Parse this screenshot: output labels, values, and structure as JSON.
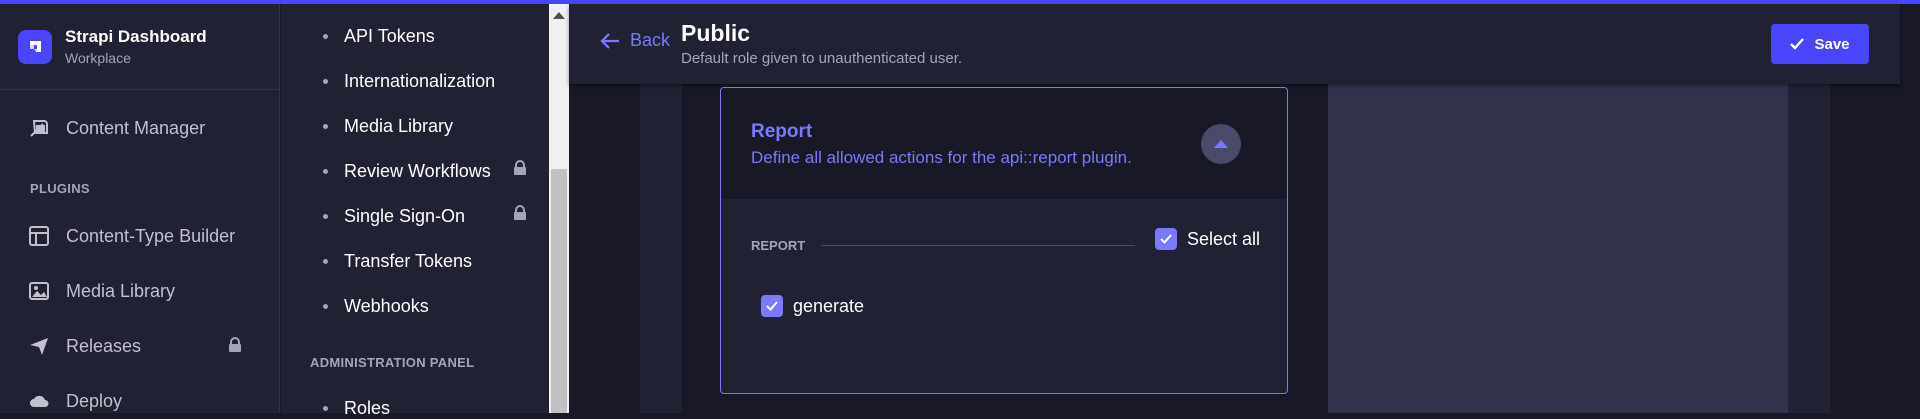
{
  "brand": {
    "title": "Strapi Dashboard",
    "subtitle": "Workplace"
  },
  "main_nav": {
    "content_manager": "Content Manager",
    "plugins_section": "PLUGINS",
    "content_type_builder": "Content-Type Builder",
    "media_library": "Media Library",
    "releases": "Releases",
    "deploy": "Deploy"
  },
  "settings_nav": {
    "items": [
      "API Tokens",
      "Internationalization",
      "Media Library",
      "Review Workflows",
      "Single Sign-On",
      "Transfer Tokens",
      "Webhooks"
    ],
    "admin_section": "ADMINISTRATION PANEL",
    "admin_items": [
      "Roles"
    ]
  },
  "header": {
    "back_label": "Back",
    "title": "Public",
    "subtitle": "Default role given to unauthenticated user.",
    "save_label": "Save"
  },
  "permissions": {
    "title": "Report",
    "description": "Define all allowed actions for the api::report plugin.",
    "section_label": "REPORT",
    "select_all_label": "Select all",
    "select_all_checked": true,
    "actions": [
      {
        "label": "generate",
        "checked": true
      }
    ]
  },
  "colors": {
    "accent": "#4945ff",
    "accent_light": "#7b79ff",
    "bg_dark": "#181826",
    "bg_panel": "#212134"
  }
}
